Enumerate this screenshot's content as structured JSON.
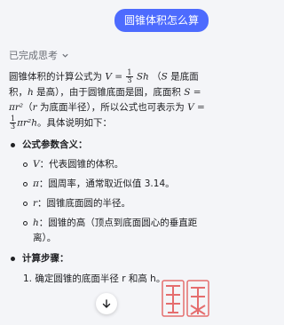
{
  "user_message": "圆锥体积怎么算",
  "thinking_label": "已完成思考",
  "answer": {
    "intro_1": "圆锥体积的计算公式为",
    "intro_formula_lhs": "V =",
    "intro_frac_num": "1",
    "intro_frac_den": "3",
    "intro_formula_rhs": "Sh",
    "intro_2": "（",
    "intro_S": "S",
    "intro_3": " 是底面积，",
    "intro_h": "h",
    "intro_4": " 是高），由于圆锥底面是圆，底面积",
    "intro_S2": "S = πr²",
    "intro_5": "（",
    "intro_r": "r",
    "intro_6": " 为底面半径），所以公式也可表示为",
    "intro_formula2_lhs": "V =",
    "intro_formula2_rhs": "πr²h",
    "intro_7": "。具体说明如下："
  },
  "section_1": {
    "title": "公式参数含义：",
    "items": [
      {
        "sym": "V",
        "text": "：代表圆锥的体积。"
      },
      {
        "sym": "π",
        "text": "：圆周率，通常取近似值 3.14。"
      },
      {
        "sym": "r",
        "text": "：圆锥底面圆的半径。"
      },
      {
        "sym": "h",
        "text": "：圆锥的高（顶点到底面圆心的垂直距离）。"
      }
    ]
  },
  "section_2": {
    "title": "计算步骤：",
    "step_1": "1. 确定圆锥的底面半径 r 和高 h。"
  },
  "colors": {
    "bubble": "#4d6bfe",
    "background": "#f4f5f8",
    "watermark": "#e04040"
  },
  "icons": {
    "thinking_toggle": "chevron-down-icon",
    "scroll_down": "arrow-down-icon",
    "watermark": "watermark-logo"
  }
}
